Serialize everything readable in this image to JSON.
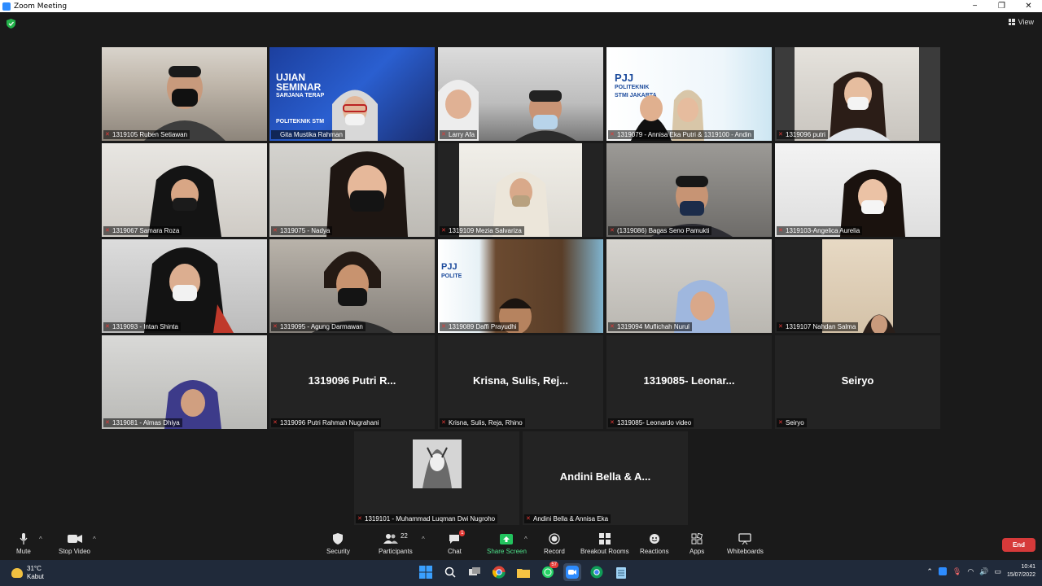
{
  "window": {
    "title": "Zoom Meeting",
    "minimize": "−",
    "maximize": "❐",
    "close": "✕"
  },
  "view_label": "View",
  "tiles": [
    {
      "label": "1319105 Ruben Setiawan"
    },
    {
      "label": "Gita Mustika Rahman",
      "poster_l1": "UJIAN",
      "poster_l2": "SEMINAR",
      "poster_l3": "SARJANA TERAP",
      "poster_l4": "POLITEKNIK STM"
    },
    {
      "label": "Larry Afa"
    },
    {
      "label": "1319079 - Annisa Eka Putri & 1319100 - Andin",
      "poster_l1": "PJJ",
      "poster_l2": "POLITEKNIK",
      "poster_l3": "STMI JAKARTA"
    },
    {
      "label": "1319096 putri"
    },
    {
      "label": "1319067 Samara Roza"
    },
    {
      "label": "1319075 - Nadya"
    },
    {
      "label": "1319109 Mezia Salvariza"
    },
    {
      "label": "(1319086) Bagas Seno Pamukti"
    },
    {
      "label": "1319103-Angelica Aurelia"
    },
    {
      "label": "1319093 - Intan Shinta"
    },
    {
      "label": "1319095 - Agung Darmawan"
    },
    {
      "label": "1319089 Daffi Prayudhi",
      "poster_l1": "PJJ",
      "poster_l2": "POLITE"
    },
    {
      "label": "1319094 Muflichah Nurul"
    },
    {
      "label": "1319107 Nahdan Salma"
    },
    {
      "label": "1319081 - Almas Dhiya"
    },
    {
      "label": "1319096 Putri Rahmah Nugrahani",
      "big": "1319096 Putri R..."
    },
    {
      "label": "Krisna, Sulis, Reja, Rhino",
      "big": "Krisna, Sulis, Rej..."
    },
    {
      "label": "1319085- Leonardo video",
      "big": "1319085- Leonar..."
    },
    {
      "label": "Seiryo",
      "big": "Seiryo"
    },
    {
      "label": "1319101 - Muhammad Luqman Dwi Nugroho"
    },
    {
      "label": "Andini Bella & Annisa Eka",
      "big": "Andini Bella & A..."
    }
  ],
  "toolbar": {
    "mute": "Mute",
    "stop_video": "Stop Video",
    "security": "Security",
    "participants": "Participants",
    "participants_count": "22",
    "chat": "Chat",
    "chat_badge": "1",
    "share_screen": "Share Screen",
    "record": "Record",
    "breakout": "Breakout Rooms",
    "reactions": "Reactions",
    "apps": "Apps",
    "whiteboards": "Whiteboards",
    "end": "End"
  },
  "taskbar": {
    "temp": "31°C",
    "weather": "Kabut",
    "whatsapp_badge": "57",
    "time": "10:41",
    "date": "15/07/2022"
  },
  "colors": {
    "active_speaker": "#e4e43c",
    "share": "#22c35e",
    "end": "#d63a3a",
    "accent": "#2d8cff"
  }
}
